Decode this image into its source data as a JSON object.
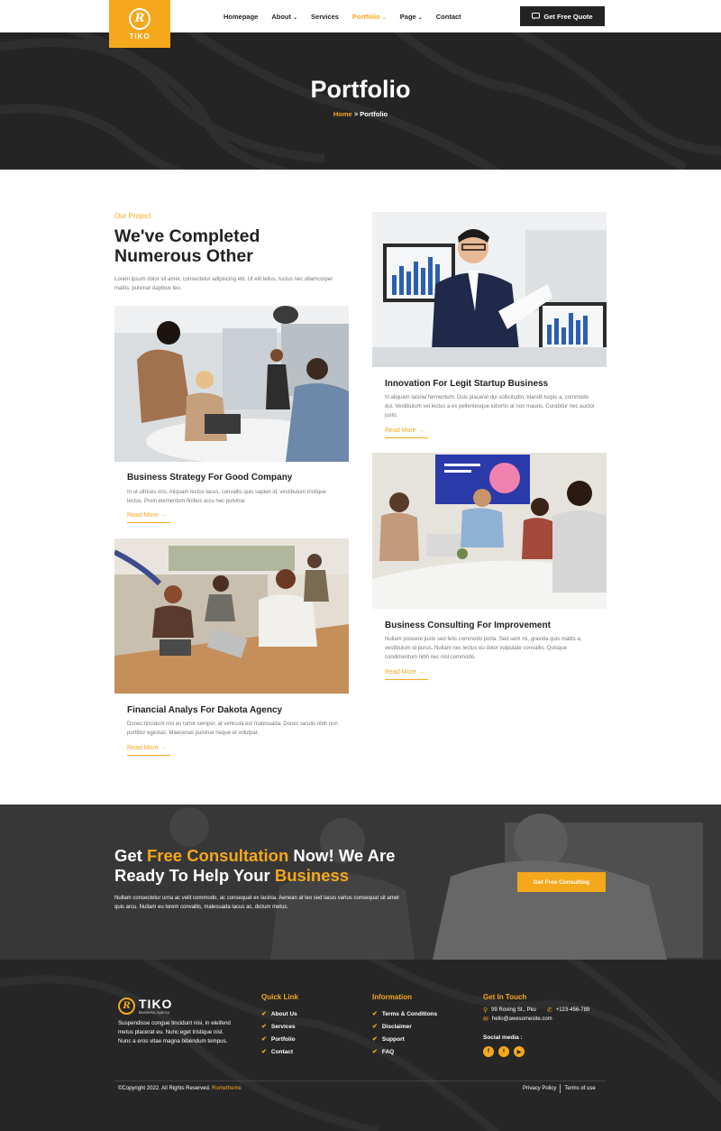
{
  "nav": {
    "logo_text": "TIKO",
    "logo_glyph": "R",
    "items": [
      {
        "label": "Homepage",
        "dropdown": false,
        "active": false
      },
      {
        "label": "About",
        "dropdown": true,
        "active": false
      },
      {
        "label": "Services",
        "dropdown": false,
        "active": false
      },
      {
        "label": "Portfolio",
        "dropdown": true,
        "active": true
      },
      {
        "label": "Page",
        "dropdown": true,
        "active": false
      },
      {
        "label": "Contact",
        "dropdown": false,
        "active": false
      }
    ],
    "cta_label": "Get Free Quote",
    "cta_icon": "chat-icon"
  },
  "hero": {
    "title": "Portfolio",
    "breadcrumb_home": "Home",
    "breadcrumb_sep": ">",
    "breadcrumb_current": "Portfolio"
  },
  "portfolio": {
    "eyebrow": "Our Project",
    "heading": "We've Completed Numerous Other",
    "intro": "Lorem ipsum dolor sit amet, consectetur adipiscing elit. Ut elit tellus, luctus nec ullamcorper mattis, pulvinar dapibus leo.",
    "read_more": "Read More →",
    "cards": [
      {
        "title": "Business Strategy For Good Company",
        "text": "In ut ultrices orci. Aliquam lectus lacus, convallis quis sapien id, vestibulum tristique lectus. Proin elementum finibus arcu nec pulvinar."
      },
      {
        "title": "Financial Analys For Dakota Agency",
        "text": "Donec tincidunt nisl eu tortor semper, at vehicula est malesuada. Donec iaculis nibh non porttitor egestas. Maecenas pulvinar neque et volutpat."
      },
      {
        "title": "Innovation For Legit Startup Business",
        "text": "In aliquam lacinia fermentum. Duis placerat dui sollicitudin, blandit turpis a, commodo dui. Vestibulum vel lectus a ex pellentesque lobortis at non mauris. Curabitur nec auctor justo."
      },
      {
        "title": "Business Consulting For Improvement",
        "text": "Nullam posuere justo sed felis commodo porta. Sed sem mi, gravida quis mattis a, vestibulum id purus. Nullam nec lectus eu dolor vulputate convallis. Quisque condimentum nibh nec nisl commodo."
      }
    ]
  },
  "cta": {
    "title_part1": "Get ",
    "title_hl1": "Free Consultation",
    "title_part2": " Now! We Are Ready To Help Your ",
    "title_hl2": "Business",
    "text": "Nullam consectetur urna ac velit commodo, ac consequat ex lacinia. Aenean at leo sed lacus varius consequat sit amet quis arcu. Nullam eu lorem convallis, malesuada lacus ac, dictum metus.",
    "button": "Get Free Consulting"
  },
  "footer": {
    "logo_name": "TIKO",
    "logo_sub": "Business Agency",
    "about": "Suspendisse congue tincidunt nisi, in eleifend metus placerat eu. Nunc eget tristique nisl. Nunc a eros vitae magna bibendum tempus.",
    "quick_title": "Quick Link",
    "quick_links": [
      "About Us",
      "Services",
      "Portfolio",
      "Contact"
    ],
    "info_title": "Information",
    "info_links": [
      "Terms & Conditions",
      "Disclaimer",
      "Support",
      "FAQ"
    ],
    "contact_title": "Get In Touch",
    "address": "99 Roving St., Pku",
    "phone": "+123-456-789",
    "email": "hello@awesomesite.com",
    "social_title": "Social media :",
    "socials": [
      "f",
      "t",
      "▶"
    ],
    "copyright": "©Copyright 2022. All Rights Reserved. ",
    "copyright_brand": "Rometheme",
    "privacy": "Privacy Policy",
    "terms": "Terms of use"
  },
  "colors": {
    "accent": "#f5a81c",
    "dark": "#242424",
    "footer": "#262626"
  }
}
